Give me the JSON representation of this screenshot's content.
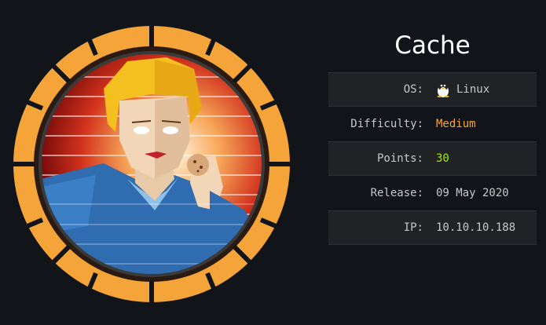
{
  "machine": {
    "name": "Cache"
  },
  "info": {
    "os_label": "OS:",
    "os_value": "Linux",
    "os_icon": "tux-linux-icon",
    "difficulty_label": "Difficulty:",
    "difficulty_value": "Medium",
    "points_label": "Points:",
    "points_value": "30",
    "release_label": "Release:",
    "release_value": "09 May 2020",
    "ip_label": "IP:",
    "ip_value": "10.10.10.188"
  },
  "colors": {
    "background": "#111519",
    "ring": "#f5a43a",
    "difficulty": "#f5a43a",
    "points": "#9fef00",
    "row_dark": "#1f2326"
  }
}
